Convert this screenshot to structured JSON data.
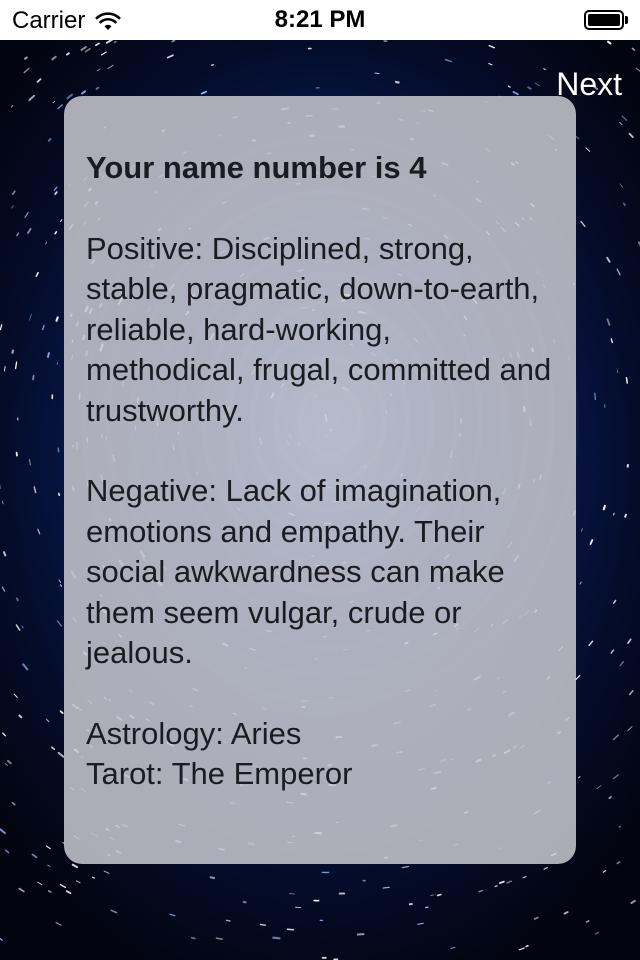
{
  "status_bar": {
    "carrier": "Carrier",
    "time": "8:21 PM",
    "wifi_icon": "wifi-icon",
    "battery_icon": "battery-icon",
    "battery_level": 1.0
  },
  "nav": {
    "next_label": "Next"
  },
  "card": {
    "heading": "Your name number is 4",
    "positive": "Positive: Disciplined, strong, stable, pragmatic, down-to-earth, reliable, hard-working, methodical, frugal, committed and trustworthy.",
    "negative": "Negative: Lack of imagination, emotions and empathy. Their social awkwardness can make them seem vulgar, crude or jealous.",
    "astrology": "Astrology: Aries",
    "tarot": "Tarot: The Emperor"
  },
  "colors": {
    "background_deep": "#02040f",
    "background_blue": "#0c2a78",
    "card": "#c8c8ce",
    "text": "#1b1b22",
    "next": "#ffffff"
  }
}
